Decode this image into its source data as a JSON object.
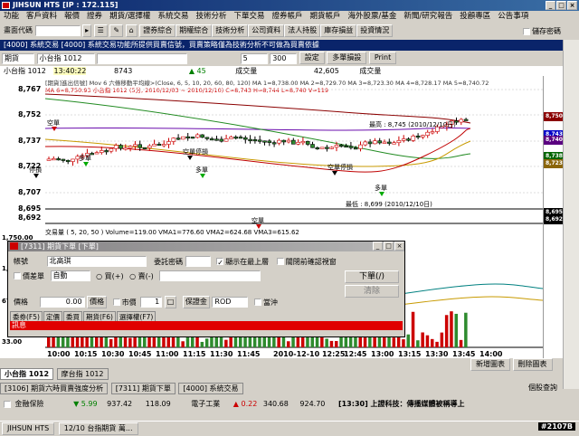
{
  "app": {
    "title": "JIHSUN HTS    [IP : 172.115]"
  },
  "menu": [
    "功能",
    "客戶資料",
    "報價",
    "證券",
    "期貨/選擇權",
    "系統交易",
    "技術分析",
    "下單交易",
    "證券帳戶",
    "期貨帳戶",
    "海外股票/基金",
    "新聞/研究報告",
    "投顧專區",
    "公告事項"
  ],
  "toolbar": {
    "code_label": "畫面代碼",
    "buttons": [
      "證券綜合",
      "期權綜合",
      "技術分析",
      "公司資料",
      "法人持股",
      "庫存損益",
      "投資情況"
    ],
    "save_password": "儲存密碼"
  },
  "inner_window": {
    "title": "[4000] 系統交易   [4000] 系統交易功能所提供買賣信號，買賣策略僅為技術分析不可做為買賣依據"
  },
  "controls": {
    "type": "期貨",
    "symbol": "小台指 1012",
    "interval": "1分",
    "period": "5",
    "bars": "300",
    "settings": "設定",
    "strategy": "多單損設",
    "print": "Print"
  },
  "info": {
    "name": "小台指 1012",
    "time": "13:40:22",
    "last": "8743",
    "change": "45",
    "volume_label": "成交量",
    "volume": "42,605",
    "high_label": "成交量"
  },
  "chart_header": {
    "line1": "[期貨]進出信號]  Mov 6 六條移動平均線>(Close, 6, 5, 10, 20, 60, 80, 120)  MA 1=8,738.00  MA 2=8,729.70  MA 3=8,723.30  MA 4=8,728.17  MA 5=8,740.72",
    "line2": "MA 6=8,750.93  小台指 1012 (5分, 2010/12/03 ~ 2010/12/10)  C=8,743 H=8,744 L=8,740 V=119"
  },
  "volume_header": "交易量 ( 5, 20, 50 )  Volume=119.00  VMA1=776.60  VMA2=624.68  VMA3=615.62",
  "annotations": {
    "high": "最高 : 8,745 (2010/12/10日)",
    "low": "最低 : 8,699 (2010/12/10日)",
    "signals": [
      "空單",
      "多單",
      "停損",
      "空單",
      "空單停損",
      "多單",
      "空單停損",
      "多單"
    ]
  },
  "y_axis": [
    "8,767",
    "8,752",
    "8,737",
    "8,722",
    "8,707",
    "8,695",
    "8,692"
  ],
  "price_tags": [
    {
      "label": "8,750.93",
      "color": "#8b0000"
    },
    {
      "label": "8,743.00",
      "color": "#0000c8"
    },
    {
      "label": "8,740.72",
      "color": "#5a0080"
    },
    {
      "label": "8,738.17",
      "color": "#006400"
    },
    {
      "label": "8,723.30",
      "color": "#8b6508"
    },
    {
      "label": "8,695",
      "color": "#000"
    },
    {
      "label": "8,692",
      "color": "#000"
    }
  ],
  "vol_axis": [
    "1,750.00",
    "1,000.00",
    "67.18",
    "33.00"
  ],
  "x_axis": [
    "10:00",
    "10:15",
    "10:30",
    "10:45",
    "11:00",
    "11:15",
    "11:30",
    "11:45",
    "2010-12-10  12:25",
    "12:45",
    "13:00",
    "13:15",
    "13:30",
    "13:45",
    "14:00"
  ],
  "order_dialog": {
    "title": "[7311] 期貨下單 [下單]",
    "account_label": "帳號",
    "account": "北高琪",
    "password_label": "委託密碼",
    "show_on_top": "顯示在最上層",
    "close_after": "關閉前確認視窗",
    "spread_label": "價差單",
    "auto": "自動",
    "buy": "買(+)",
    "sell": "賣(-)",
    "price_label": "價格",
    "price": "0.00",
    "price_btn": "價格",
    "market": "市價",
    "qty": "1",
    "cond_label": "保證金",
    "cond": "ROD",
    "daytrade": "當沖",
    "place": "下單(/)",
    "clear": "清除",
    "tabs": [
      "委券(F5)",
      "定價",
      "委買",
      "期貨(F6)",
      "選擇權(F7)"
    ],
    "message_label": "訊息"
  },
  "bottom_buttons": [
    "新增圖表",
    "刪除圖表"
  ],
  "tabs": [
    "小台指 1012",
    "摩台指 1012"
  ],
  "window_tabs": [
    "[3106] 期貨六時買賣強度分析",
    "[7311] 期貨下單",
    "[4000] 系統交易"
  ],
  "status": {
    "rate_label": "個股查詢",
    "row1": [
      {
        "label": "金融保險",
        "val": "5.99"
      },
      {
        "label": "937.42",
        "val": "118.09"
      },
      {
        "label": "電子工業",
        "val": "0.22"
      },
      {
        "label": "340.68",
        "val": "924.70"
      },
      {
        "label": "[13:30] 上證科技：傳播媒體被稱導上",
        "val": ""
      }
    ],
    "id_label": "#2107B"
  },
  "taskbar": {
    "start": "JIHSUN HTS",
    "clock": "12/10 台指期貨 萬..."
  }
}
